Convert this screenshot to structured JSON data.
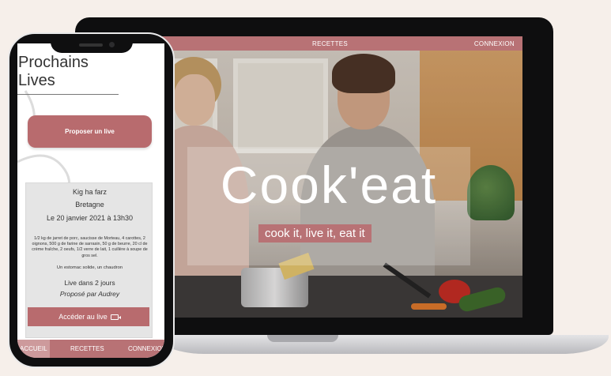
{
  "desktop": {
    "nav": {
      "recettes": "RECETTES",
      "connexion": "CONNEXION"
    },
    "hero": {
      "title": "Cook'eat",
      "tagline": "cook it, live it, eat it"
    }
  },
  "mobile": {
    "title": "Prochains Lives",
    "propose_button": "Proposer un live",
    "live_card": {
      "name": "Kig ha farz",
      "region": "Bretagne",
      "date": "Le 20 janvier 2021 à 13h30",
      "ingredients": "1/2 kg de jarret de porc, saucisse de Morteau, 4 carottes, 2 oignons, 500 g de farine de sarrasin, 50 g de beurre, 20 cl de crème fraîche, 2 oeufs, 1/2 verre de lait, 1 cuillère à soupe de gros sel.",
      "tools": "Un estomac solide, un chaudron",
      "when": "Live dans 2 jours",
      "author": "Proposé par Audrey",
      "access_button": "Accéder au live"
    },
    "nav": {
      "accueil": "ACCUEIL",
      "recettes": "RECETTES",
      "connexion": "CONNEXION"
    }
  },
  "colors": {
    "accent": "#b87275",
    "background": "#f6efea"
  }
}
